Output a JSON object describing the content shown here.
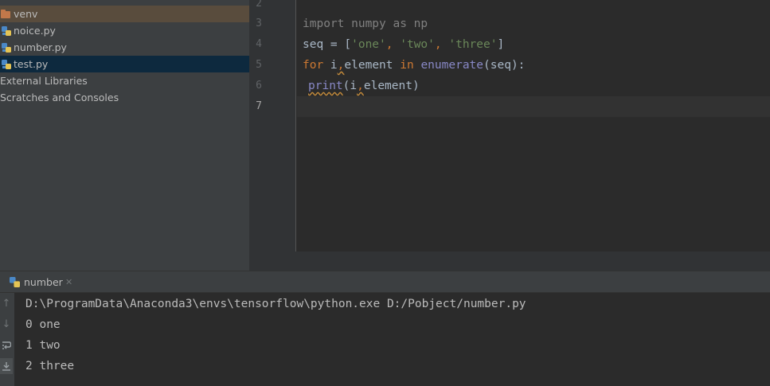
{
  "project_tree": {
    "items": [
      {
        "label": "venv",
        "kind": "folder"
      },
      {
        "label": "noice.py",
        "kind": "python"
      },
      {
        "label": "number.py",
        "kind": "python"
      },
      {
        "label": "test.py",
        "kind": "python"
      },
      {
        "label": "External Libraries",
        "kind": "root"
      },
      {
        "label": "Scratches and Consoles",
        "kind": "root"
      }
    ]
  },
  "editor": {
    "line_numbers": [
      "2",
      "3",
      "4",
      "5",
      "6",
      "7"
    ],
    "current_line": "7",
    "code": {
      "line3": "import numpy as np",
      "line4_a": "seq = [",
      "line4_s1": "'one'",
      "line4_c1": ", ",
      "line4_s2": "'two'",
      "line4_c2": ", ",
      "line4_s3": "'three'",
      "line4_b": "]",
      "line5_for": "for",
      "line5_i": " i",
      "line5_comma": ",",
      "line5_el": "element ",
      "line5_in": "in",
      "line5_enum": " enumerate",
      "line5_rest": "(seq):",
      "line6_print": "print",
      "line6_open": "(i",
      "line6_comma": ",",
      "line6_rest": "element)"
    }
  },
  "run_panel": {
    "tab_label": "number",
    "output": [
      "D:\\ProgramData\\Anaconda3\\envs\\tensorflow\\python.exe D:/Pobject/number.py",
      "0 one",
      "1 two",
      "2 three"
    ]
  },
  "colors": {
    "keyword": "#cc7832",
    "string": "#6a8759",
    "builtin": "#8888c6",
    "selection": "#0d293e",
    "folder": "#c1784a"
  }
}
